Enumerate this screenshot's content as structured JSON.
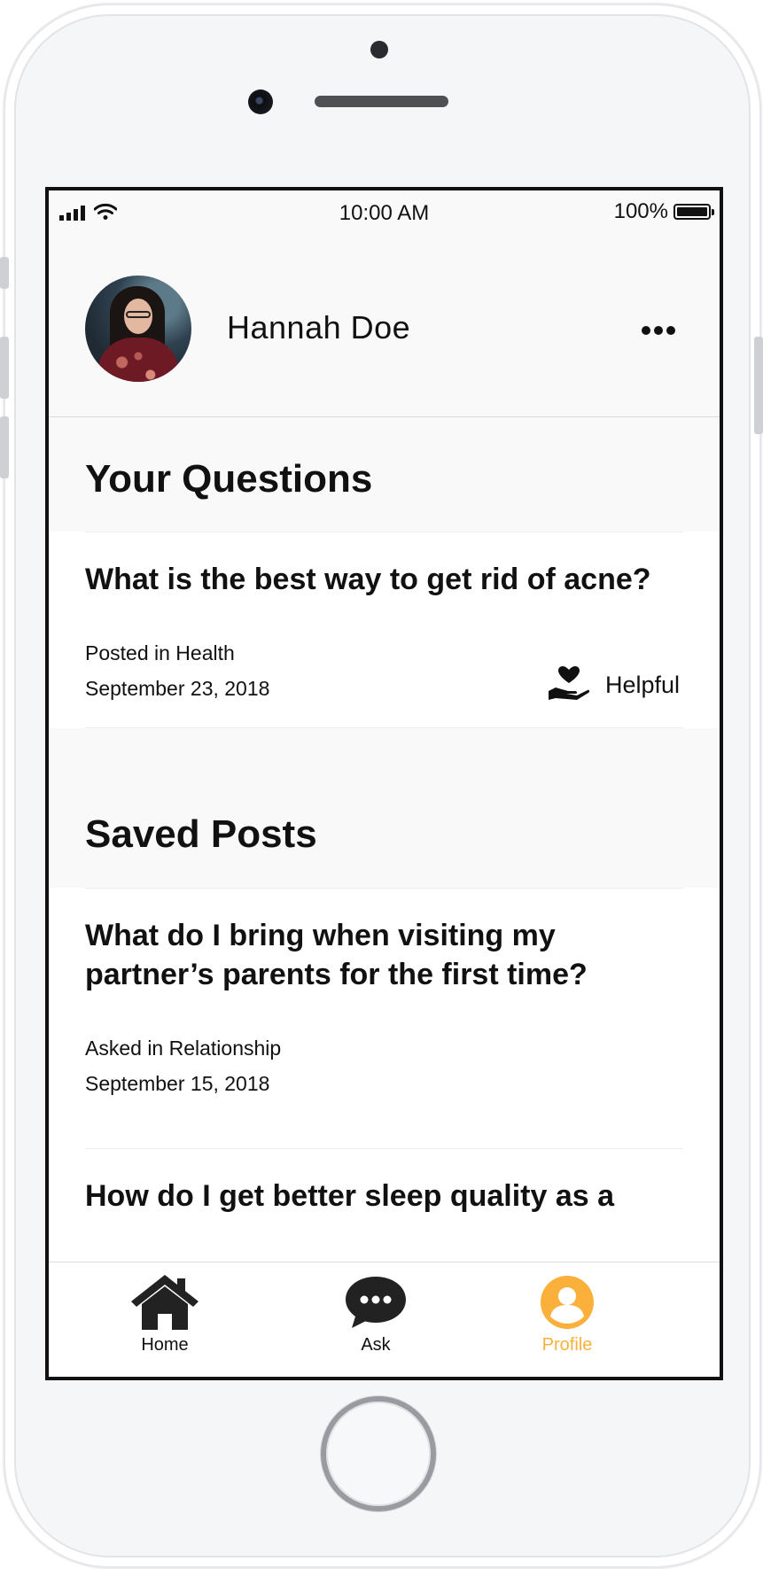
{
  "status_bar": {
    "time": "10:00 AM",
    "battery": "100%"
  },
  "profile": {
    "name": "Hannah Doe"
  },
  "your_questions": {
    "title": "Your Questions",
    "items": [
      {
        "question": "What is the best way to get rid of acne?",
        "category": "Posted in Health",
        "date": "September 23, 2018",
        "helpful_label": "Helpful"
      }
    ]
  },
  "saved_posts": {
    "title": "Saved Posts",
    "items": [
      {
        "question": "What do I bring when visiting my partner’s parents for the first time?",
        "category": "Asked in Relationship",
        "date": "September 15, 2018"
      },
      {
        "question": "How do I get better sleep quality as a"
      }
    ]
  },
  "tab_bar": {
    "tabs": [
      {
        "label": "Home",
        "icon": "home-icon"
      },
      {
        "label": "Ask",
        "icon": "chat-bubble-icon"
      },
      {
        "label": "Profile",
        "icon": "profile-icon",
        "active": true
      }
    ],
    "active_color": "#fbb03b"
  }
}
